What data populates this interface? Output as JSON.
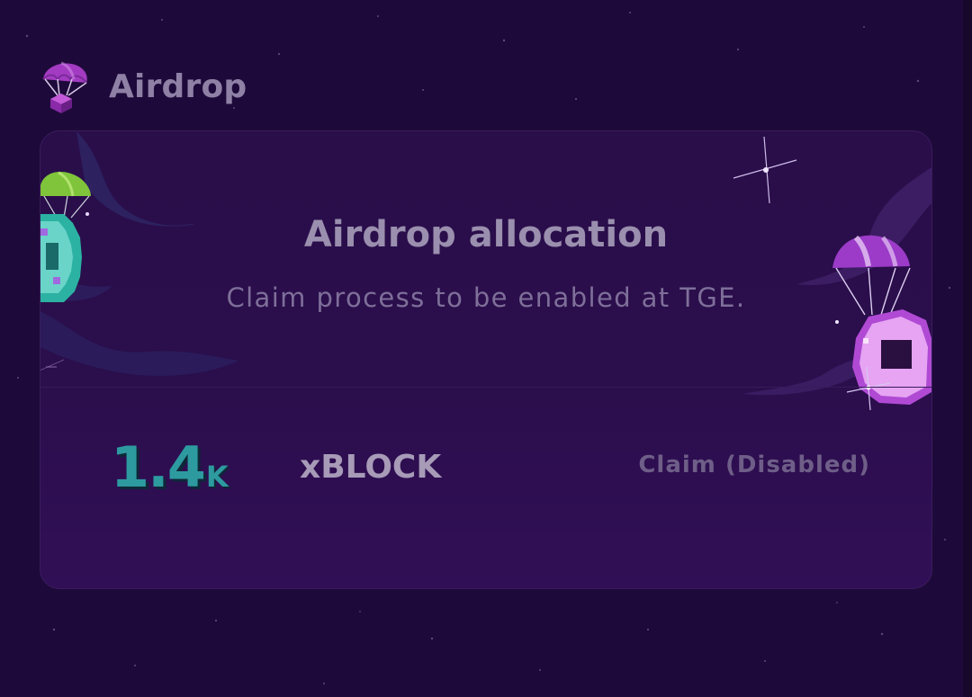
{
  "header": {
    "title": "Airdrop",
    "icon": "parachute-box-icon"
  },
  "card": {
    "title": "Airdrop allocation",
    "subtitle": "Claim process to be enabled at TGE.",
    "amount": {
      "value": "1.4",
      "suffix": "K"
    },
    "token_symbol": "xBLOCK",
    "claim_button_label": "Claim (Disabled)"
  },
  "colors": {
    "background": "#1e0a3a",
    "card_background": "#2a0e4a",
    "amount": "#2d9aa0",
    "title_text": "#9a8fae",
    "accent_purple": "#9b3bc8",
    "accent_green": "#7fc43a"
  },
  "decorations": {
    "left": [
      "parachute-icon",
      "pixel-coin-icon",
      "sparkle-icon"
    ],
    "right": [
      "parachute-icon",
      "pixel-coin-icon",
      "sparkle-icon"
    ]
  }
}
